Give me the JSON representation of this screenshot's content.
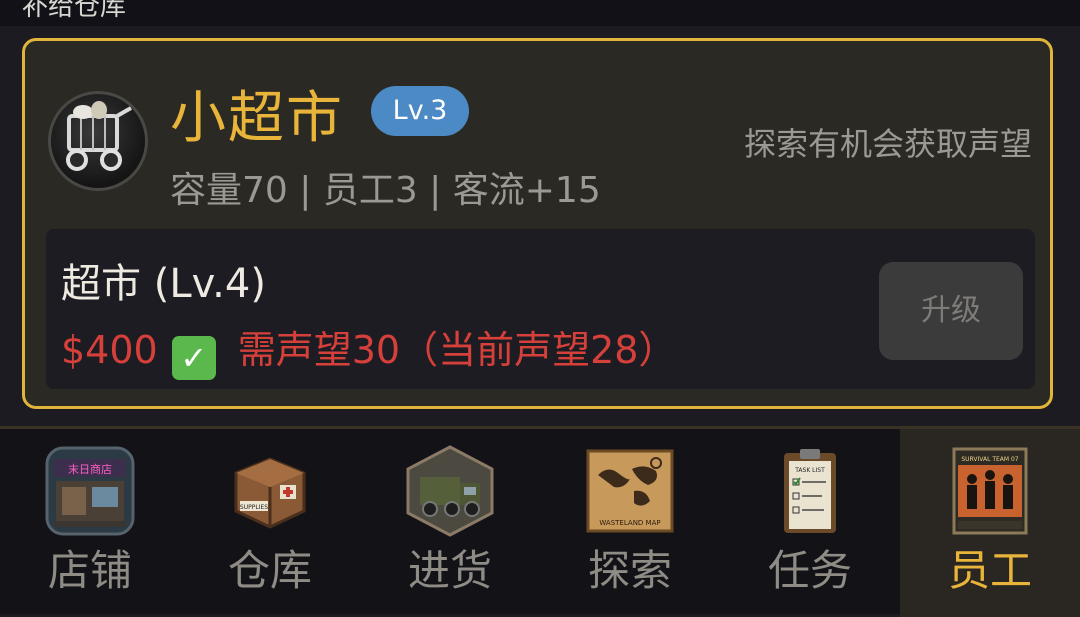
{
  "top_partial_text": "补给仓库",
  "store": {
    "title": "小超市",
    "level": "Lv.3",
    "stats": "容量70 | 员工3 | 客流+15",
    "hint": "探索有机会获取声望",
    "icon": "shopping-cart-icon"
  },
  "upgrade": {
    "name": "超市 (Lv.4)",
    "cost": "$400",
    "cost_met_icon": "✅",
    "reputation_req": "需声望30（当前声望28）",
    "button_label": "升级"
  },
  "nav": {
    "tabs": [
      {
        "label": "店铺",
        "icon": "storefront-icon",
        "icon_text": "末日商店"
      },
      {
        "label": "仓库",
        "icon": "supply-crate-icon",
        "icon_text": "SUPPLIES"
      },
      {
        "label": "进货",
        "icon": "truck-icon"
      },
      {
        "label": "探索",
        "icon": "map-icon",
        "icon_text": "WASTELAND MAP"
      },
      {
        "label": "任务",
        "icon": "clipboard-icon",
        "icon_text": "TASK LIST"
      },
      {
        "label": "员工",
        "icon": "team-icon",
        "icon_text": "SURVIVAL TEAM 07"
      }
    ],
    "active_tab": "员工"
  },
  "colors": {
    "accent": "#e8b43a",
    "badge": "#4b8ac4",
    "warning": "#d6403a",
    "success": "#5bb84c"
  }
}
